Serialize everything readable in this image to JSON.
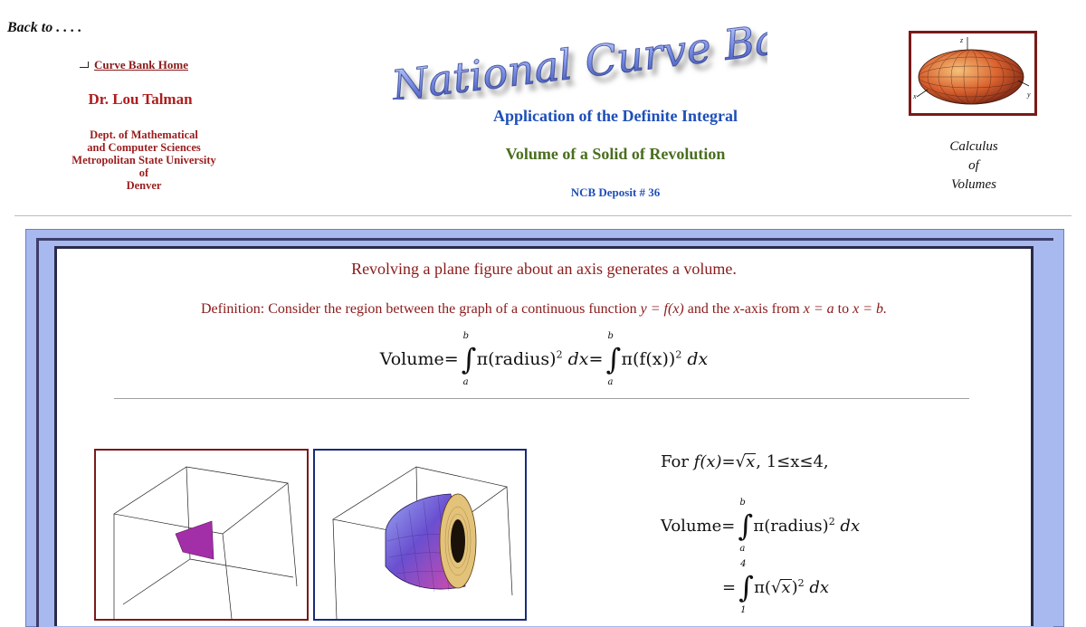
{
  "header": {
    "back_label": "Back to . . . .",
    "home_link": "Curve Bank Home",
    "author": "Dr. Lou Talman",
    "dept_lines": [
      "Dept. of Mathematical",
      "and Computer Sciences",
      "Metropolitan State University",
      "of",
      "Denver"
    ],
    "logo_text": "National Curve Bank",
    "app_title": "Application of the Definite Integral",
    "vol_title": "Volume of a Solid of Revolution",
    "deposit": "NCB Deposit  # 36",
    "caption_lines": [
      "Calculus",
      "of",
      "Volumes"
    ],
    "thumb_axes": {
      "z": "z",
      "x": "x",
      "y": "y"
    }
  },
  "main": {
    "intro": "Revolving a plane figure about an axis generates a volume.",
    "definition": {
      "lead": "Definition:  Consider the region between the graph of a continuous function ",
      "fn": "y = f(x)",
      "mid": " and the ",
      "axis": "x",
      "mid2": "-axis from ",
      "from": "x =  a",
      "to_word": " to ",
      "to": "x =  b."
    },
    "formula": {
      "lhs": "Volume",
      "eq": "=",
      "upper": "b",
      "lower": "a",
      "term1": "π(radius)",
      "sq": "2",
      "dx": "dx",
      "term2": "π(f(x))"
    },
    "example": {
      "for": "For ",
      "fx": "f(x)",
      "eq": "=",
      "rad_var": "x",
      "range": ",  1≤x≤4,",
      "vol_lhs": "Volume",
      "upper1": "b",
      "lower1": "a",
      "term1": "π(radius)",
      "sq": "2",
      "dx": "dx",
      "upper2": "4",
      "lower2": "1",
      "term2_open": "π(",
      "term2_close": ")"
    }
  },
  "colors": {
    "maroon": "#8b1a1a",
    "blue_title": "#1e4fb8",
    "green_title": "#4a6e1f",
    "frame_blue": "#a7b9ee",
    "panel_a_border": "#7a1a1a",
    "panel_b_border": "#1a2a7a"
  }
}
